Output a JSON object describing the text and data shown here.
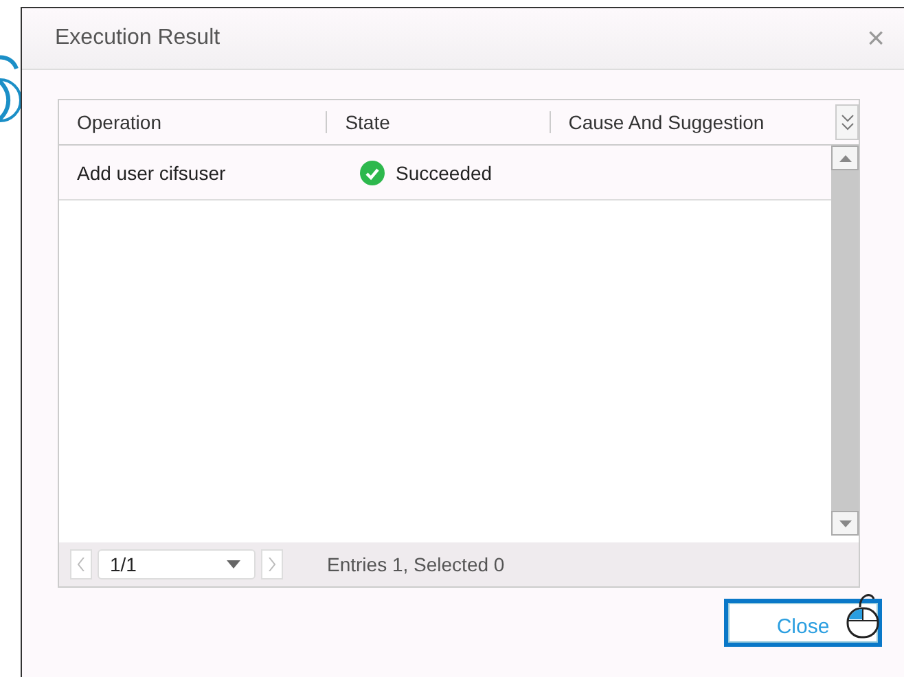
{
  "window": {
    "title": "Execution Result",
    "close": "×"
  },
  "table": {
    "columns": [
      "Operation",
      "State",
      "Cause And Suggestion"
    ],
    "rows": [
      {
        "operation": "Add user cifsuser",
        "state": "Succeeded",
        "kind": "success"
      }
    ]
  },
  "pager": {
    "page": "1/1",
    "summary": "Entries 1, Selected 0"
  },
  "buttons": [
    {
      "label": "Close",
      "focused": true
    }
  ]
}
